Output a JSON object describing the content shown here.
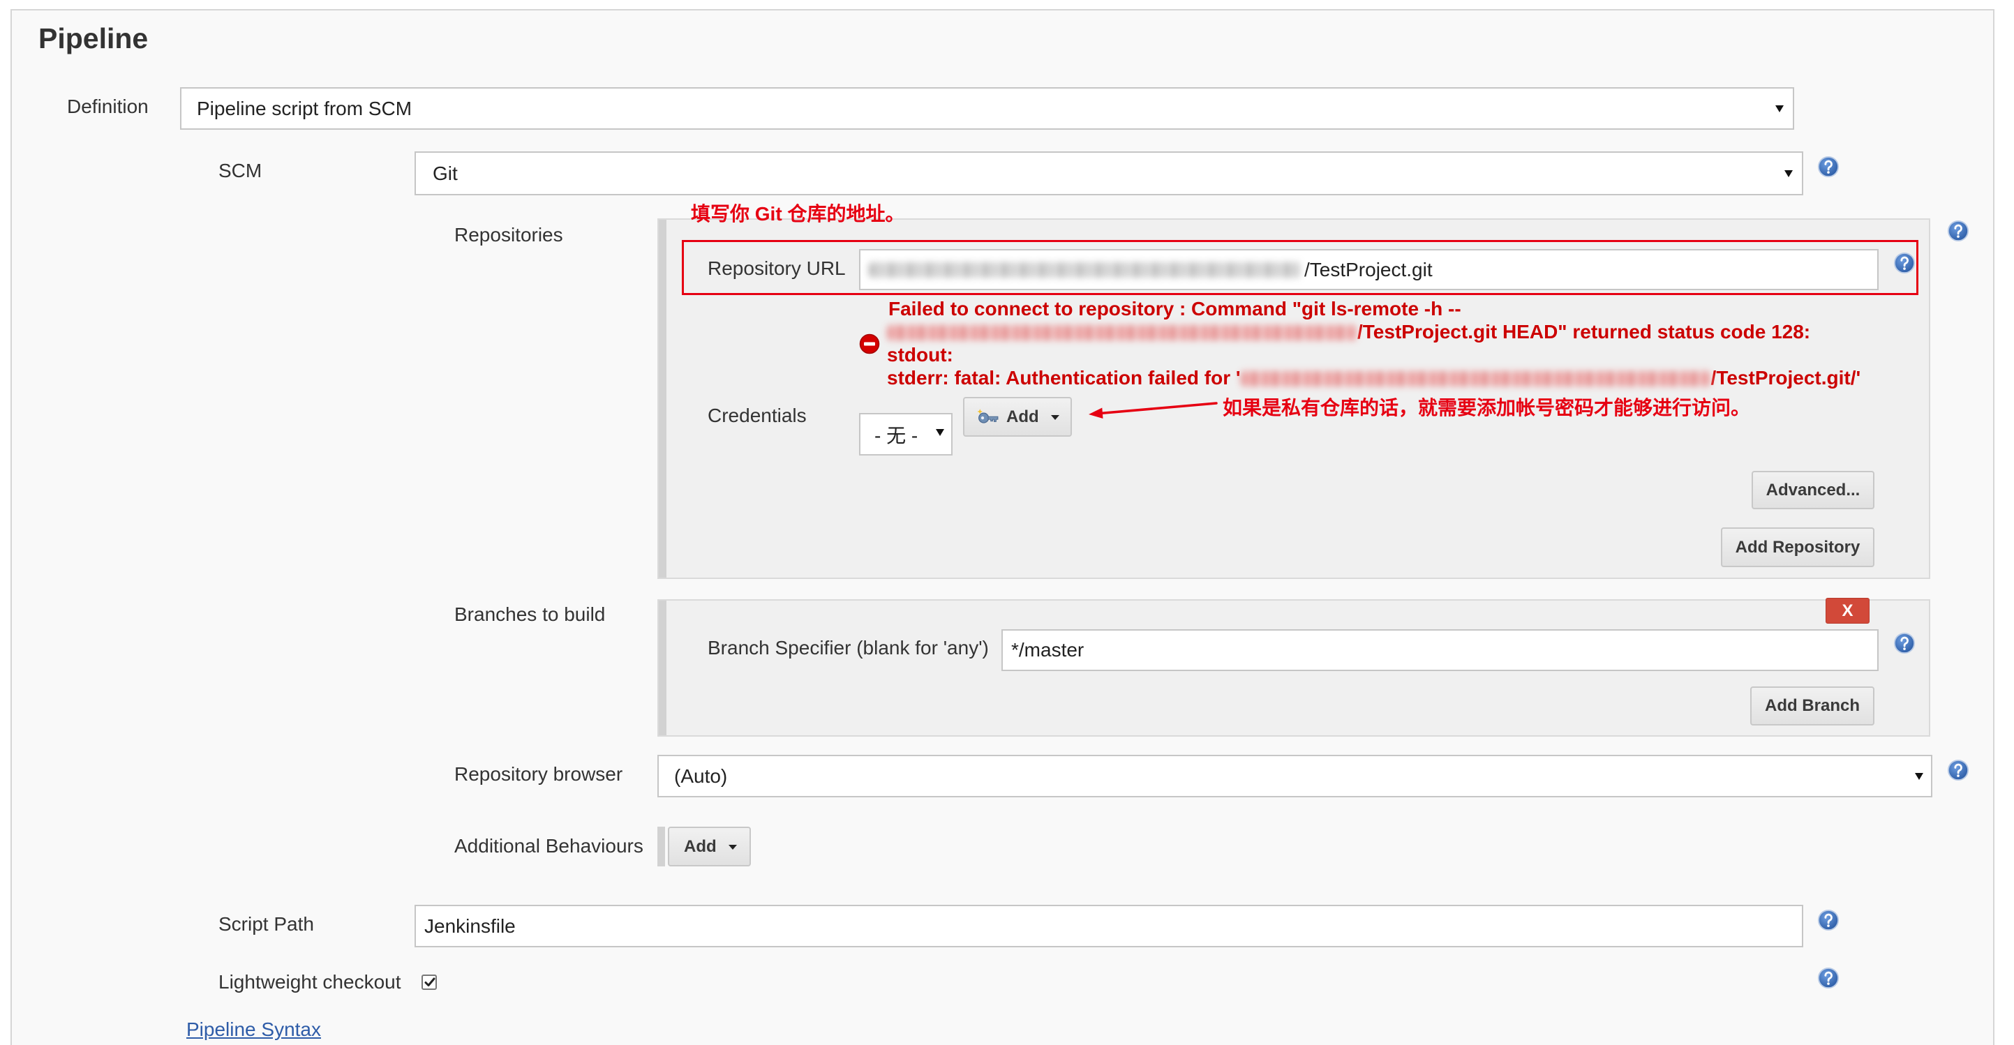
{
  "section": {
    "title": "Pipeline"
  },
  "definition": {
    "label": "Definition",
    "value": "Pipeline script from SCM"
  },
  "scm": {
    "label": "SCM",
    "value": "Git"
  },
  "repositories": {
    "label": "Repositories",
    "url": {
      "label": "Repository URL",
      "visible_value": "/TestProject.git"
    },
    "error": {
      "line1": "Failed to connect to repository : Command \"git ls-remote -h --",
      "line2_after_redaction": "/TestProject.git HEAD\" returned status code 128:",
      "line3": "stdout:",
      "line4_before_redaction": "stderr: fatal: Authentication failed for '",
      "line4_after_redaction": "/TestProject.git/'"
    },
    "credentials": {
      "label": "Credentials",
      "value": "- 无 -",
      "add_label": "Add"
    },
    "advanced_label": "Advanced...",
    "add_repository_label": "Add Repository"
  },
  "branches": {
    "label": "Branches to build",
    "delete_label": "X",
    "specifier_label": "Branch Specifier (blank for 'any')",
    "specifier_value": "*/master",
    "add_branch_label": "Add Branch"
  },
  "repository_browser": {
    "label": "Repository browser",
    "value": "(Auto)"
  },
  "additional_behaviours": {
    "label": "Additional Behaviours",
    "add_label": "Add"
  },
  "script_path": {
    "label": "Script Path",
    "value": "Jenkinsfile"
  },
  "lightweight_checkout": {
    "label": "Lightweight checkout",
    "checked": true
  },
  "links": {
    "pipeline_syntax": "Pipeline Syntax"
  },
  "annotations": {
    "repository_url_hint": "填写你 Git 仓库的地址。",
    "credentials_hint": "如果是私有仓库的话，就需要添加帐号密码才能够进行访问。"
  },
  "colors": {
    "page_background": "#f9f9f9",
    "panel_background": "#f0f0f0",
    "error_text": "#cc0000",
    "annotation_red": "#e60012",
    "help_icon_blue": "#3d72b8",
    "delete_button": "#d24939",
    "link": "#2e5ca8"
  },
  "icons": {
    "help": "help-icon",
    "error": "error-icon",
    "credentials_key": "key-icon",
    "dropdown": "chevron-down-icon",
    "checkbox": "checkmark-icon",
    "annotation_arrow": "arrow-left-icon"
  }
}
